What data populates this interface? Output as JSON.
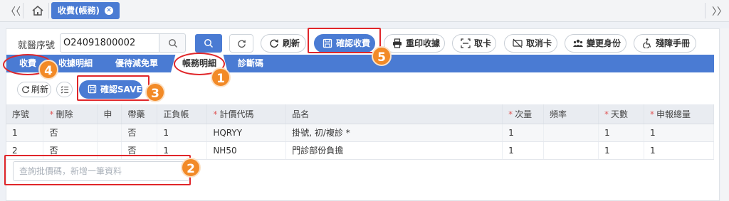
{
  "topbar": {
    "left_arrow": "〈〈",
    "right_arrow": "〉〉",
    "active_tab": "收費(帳務)",
    "close_glyph": "✕"
  },
  "visit": {
    "label": "就醫序號",
    "value": "O24091800002"
  },
  "actions": {
    "refresh": "刷新",
    "confirm_charge": "確認收費",
    "reprint": "重印收據",
    "take_card": "取卡",
    "cancel_card": "取消卡",
    "change_identity": "變更身份",
    "disability_manual": "殘障手冊"
  },
  "subtabs": {
    "charge": "收費",
    "receipt_detail": "收據明細",
    "discount": "優待減免單",
    "account_detail": "帳務明細",
    "diagnosis_code": "診斷碼"
  },
  "toolbar": {
    "refresh": "刷新",
    "save": "確認SAVE"
  },
  "table": {
    "headers": {
      "seq": "序號",
      "delete": "刪除",
      "apply": "申",
      "take_med": "帶藥",
      "positive_account": "正負帳",
      "price_code": "計價代碼",
      "item_name": "品名",
      "quantity": "次量",
      "frequency": "頻率",
      "days": "天數",
      "total": "申報總量"
    },
    "rows": [
      {
        "seq": "1",
        "delete": "否",
        "apply": "",
        "take_med": "否",
        "positive_account": "1",
        "price_code": "HQRYY",
        "item_name": "掛號, 初/複診 *",
        "quantity": "1",
        "frequency": "",
        "days": "1",
        "total": "1"
      },
      {
        "seq": "2",
        "delete": "否",
        "apply": "",
        "take_med": "否",
        "positive_account": "1",
        "price_code": "NH50",
        "item_name": "門診部份負擔",
        "quantity": "1",
        "frequency": "",
        "days": "1",
        "total": "1"
      }
    ]
  },
  "query": {
    "placeholder": "查詢批價碼，新增一筆資料"
  },
  "annotations": {
    "one": "1",
    "two": "2",
    "three": "3",
    "four": "4",
    "five": "5"
  },
  "colors": {
    "accent": "#4a7bd3",
    "annotation_red": "#e0262a",
    "badge_orange": "#f28a27"
  }
}
